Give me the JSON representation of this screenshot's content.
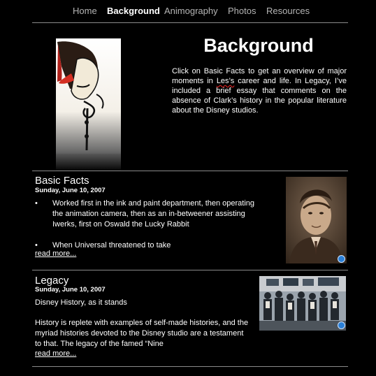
{
  "nav": {
    "items": [
      {
        "label": "Home"
      },
      {
        "label": "Background"
      },
      {
        "label": "Animography"
      },
      {
        "label": "Photos"
      },
      {
        "label": "Resources"
      }
    ],
    "active_index": 1
  },
  "hero": {
    "title": "Background",
    "text_before": "Click on Basic Facts to get an overview of major moments in ",
    "text_misspelled": "Les’s",
    "text_after": " career and life.  In Legacy, I’ve included a brief essay that comments on the absence of Clark’s history in the popular literature about the Disney studios."
  },
  "posts": [
    {
      "title": "Basic Facts",
      "date": "Sunday, June 10, 2007",
      "bullets": [
        "Worked first in the ink and paint department, then operating the animation camera, then as an in-betweener assisting Iwerks, first on Oswald the Lucky Rabbit",
        "When Universal threatened to take"
      ],
      "bullet_char": "•",
      "read_more": "read more..."
    },
    {
      "title": "Legacy",
      "date": "Sunday, June 10, 2007",
      "subtitle": "Disney History, as it stands",
      "paragraph": "History is replete with examples of self-made histories, and the myriad histories devoted to the Disney studio are a testament to that.  The legacy of the famed “Nine",
      "read_more": "read more..."
    }
  ],
  "colors": {
    "background": "#000000",
    "nav_inactive": "#b5b5b5",
    "rule": "#8a8a8a",
    "badge": "#2a7fd6"
  }
}
